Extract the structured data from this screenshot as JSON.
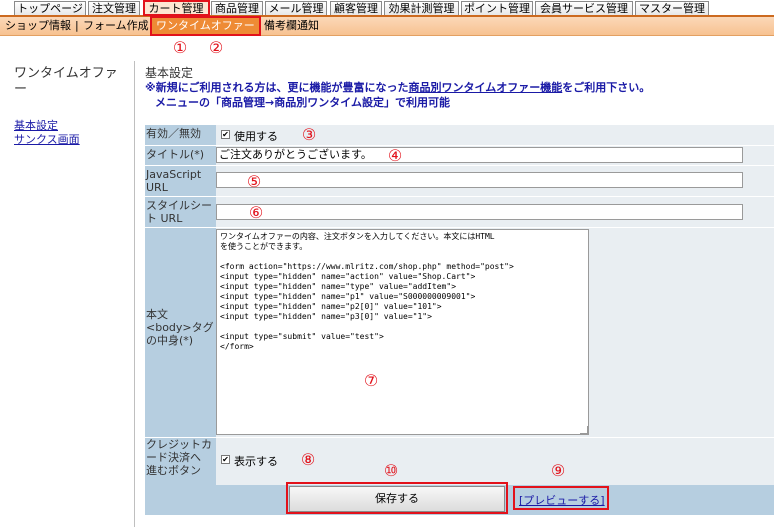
{
  "top_tabs": [
    "トップページ",
    "注文管理",
    "カート管理",
    "商品管理",
    "メール管理",
    "顧客管理",
    "効果計測管理",
    "ポイント管理",
    "会員サービス管理",
    "マスター管理"
  ],
  "sub_nav": {
    "items": [
      "ショップ情報",
      "フォーム作成",
      "ワンタイムオファー",
      "備考欄通知"
    ],
    "separator": "|"
  },
  "sidebar": {
    "title": "ワンタイムオファー",
    "links": [
      "基本設定",
      "サンクス画面"
    ]
  },
  "section": {
    "title": "基本設定",
    "notice_prefix": "※新規にご利用される方は、更に機能が豊富になった",
    "notice_link": "商品別ワンタイムオファー機能",
    "notice_suffix": "をご利用下さい。",
    "notice_line2": "メニューの「商品管理→商品別ワンタイム設定」で利用可能"
  },
  "form": {
    "enabled": {
      "label": "有効／無効",
      "option": "使用する",
      "checked": true
    },
    "title_field": {
      "label": "タイトル(*)",
      "value": "ご注文ありがとうございます。"
    },
    "js_url": {
      "label_line1": "JavaScript",
      "label_line2": "URL",
      "value": ""
    },
    "css_url": {
      "label_line1": "スタイルシー",
      "label_line2": "ト URL",
      "value": ""
    },
    "body": {
      "label_line1": "本文",
      "label_line2": "<body>タグ",
      "label_line3": "の中身(*)",
      "value": "ワンタイムオファーの内容、注文ボタンを入力してください。本文にはHTML\nを使うことができます。\n\n<form action=\"https://www.mlritz.com/shop.php\" method=\"post\">\n<input type=\"hidden\" name=\"action\" value=\"Shop.Cart\">\n<input type=\"hidden\" name=\"type\" value=\"addItem\">\n<input type=\"hidden\" name=\"p1\" value=\"S000000009001\">\n<input type=\"hidden\" name=\"p2[0]\" value=\"101\">\n<input type=\"hidden\" name=\"p3[0]\" value=\"1\">\n\n<input type=\"submit\" value=\"test\">\n</form>"
    },
    "credit": {
      "label_line1": "クレジットカ",
      "label_line2": "ード決済へ",
      "label_line3": "進むボタン",
      "option": "表示する",
      "checked": true
    }
  },
  "buttons": {
    "save": "保存する",
    "preview": "[プレビューする]"
  },
  "annotations": [
    "①",
    "②",
    "③",
    "④",
    "⑤",
    "⑥",
    "⑦",
    "⑧",
    "⑨",
    "⑩"
  ],
  "colors": {
    "accent_orange": "#ee8b35",
    "label_bg": "#b6cee0",
    "annotation_red": "#e2121b",
    "notice_blue": "#1a1aa6"
  }
}
